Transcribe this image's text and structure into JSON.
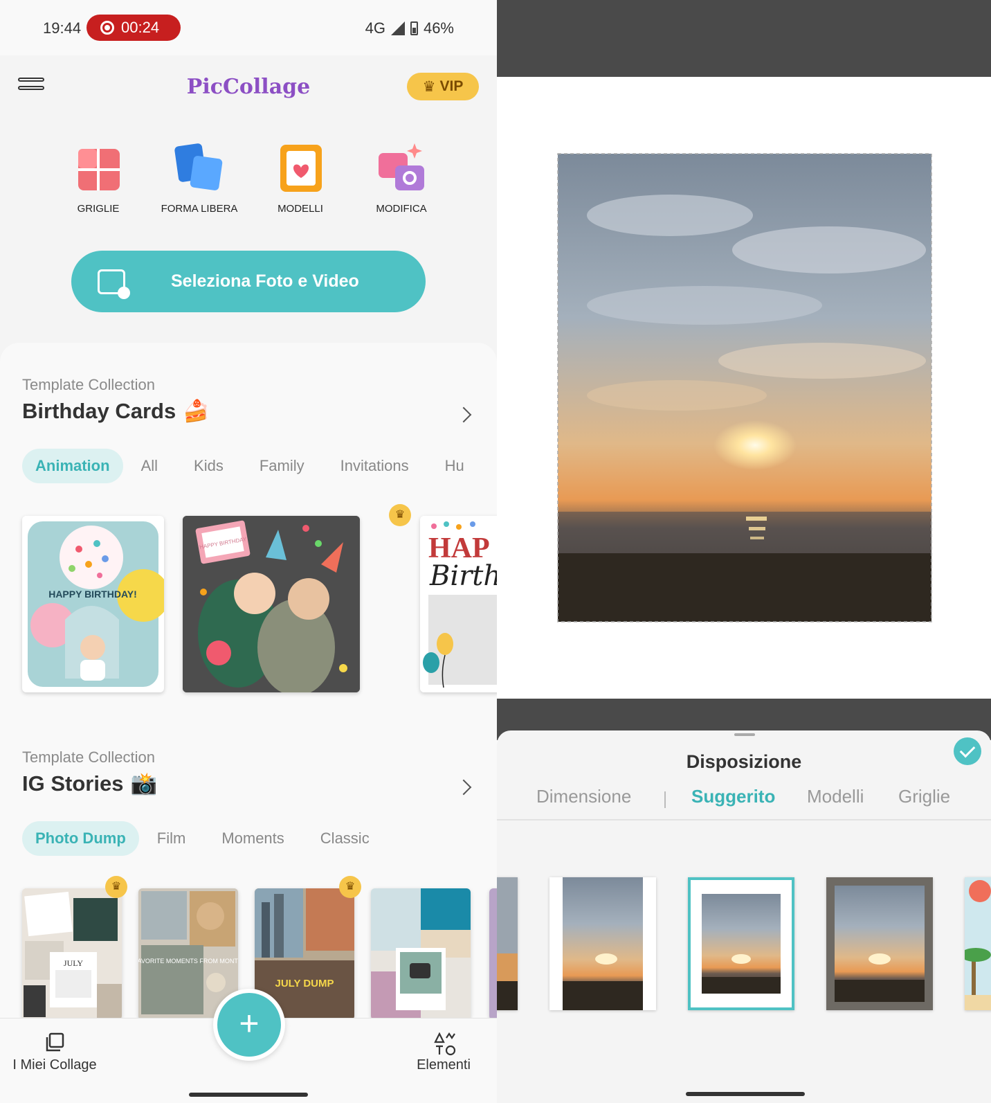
{
  "status_bar": {
    "time": "19:44",
    "recording": "00:24",
    "network": "4G",
    "battery": "46%"
  },
  "app_bar": {
    "logo": "PicCollage",
    "vip_label": "VIP"
  },
  "tools": [
    {
      "label": "GRIGLIE",
      "icon": "grid-icon"
    },
    {
      "label": "FORMA LIBERA",
      "icon": "freeform-icon"
    },
    {
      "label": "MODELLI",
      "icon": "templates-icon"
    },
    {
      "label": "MODIFICA",
      "icon": "edit-photo-icon"
    }
  ],
  "cta": {
    "label": "Seleziona Foto e Video"
  },
  "birthday": {
    "subtitle": "Template Collection",
    "title": "Birthday Cards",
    "emoji": "🍰",
    "chips": [
      "Animation",
      "All",
      "Kids",
      "Family",
      "Invitations",
      "Hu"
    ],
    "card1_text": "HAPPY BIRTHDAY!",
    "card2_text": "HAPPY BIRTHDAY",
    "card3_text": "HAP",
    "card3_script": "Birth"
  },
  "ig": {
    "subtitle": "Template Collection",
    "title": "IG Stories",
    "emoji": "📸",
    "chips": [
      "Photo Dump",
      "Film",
      "Moments",
      "Classic"
    ],
    "card1_text": "JULY",
    "card2_text": "FAVORITE MOMENTS FROM MONTH",
    "card3_text": "JULY DUMP"
  },
  "bottom_nav": {
    "left_label": "I Miei Collage",
    "right_label": "Elementi",
    "fab": "+"
  },
  "right_panel": {
    "title": "Disposizione",
    "tabs": [
      "Dimensione",
      "Suggerito",
      "Modelli",
      "Griglie"
    ],
    "active_tab": "Suggerito"
  },
  "colors": {
    "accent": "#4fc2c4",
    "accent_text": "#3ab3b5",
    "record": "#c71f1f",
    "vip": "#f6c54a"
  }
}
